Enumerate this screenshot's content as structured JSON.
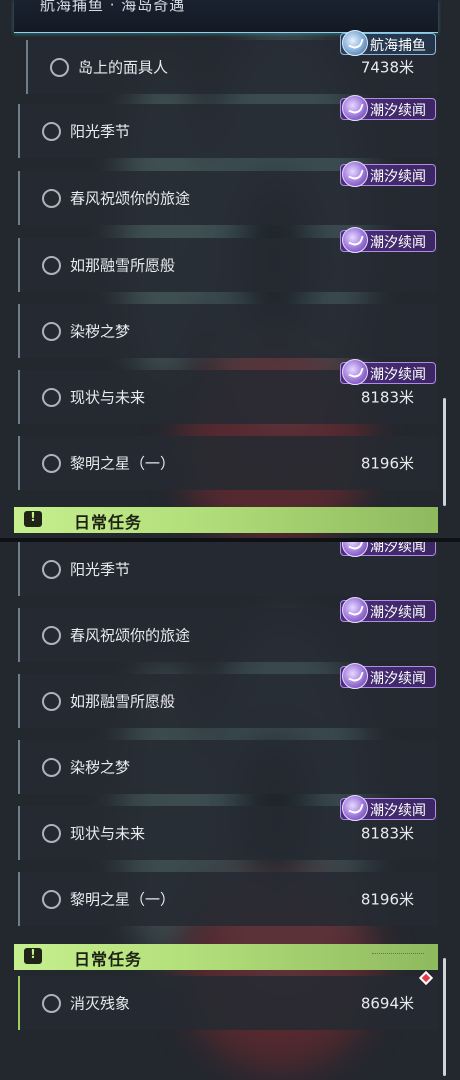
{
  "top_panel": {
    "header_text": "航海捕鱼 · 海岛奇遇",
    "quests": [
      {
        "title": "岛上的面具人",
        "distance": "7438米",
        "badge": "航海捕鱼"
      },
      {
        "title": "阳光季节",
        "distance": "",
        "badge": "潮汐续闻"
      },
      {
        "title": "春风祝颂你的旅途",
        "distance": "",
        "badge": "潮汐续闻"
      },
      {
        "title": "如那融雪所愿般",
        "distance": "",
        "badge": "潮汐续闻"
      },
      {
        "title": "染秽之梦",
        "distance": "",
        "badge": ""
      },
      {
        "title": "现状与未来",
        "distance": "8183米",
        "badge": "潮汐续闻"
      },
      {
        "title": "黎明之星（一）",
        "distance": "8196米",
        "badge": ""
      }
    ],
    "section_title": "日常任务"
  },
  "bottom_panel": {
    "partial_badge": "潮汐续闻",
    "quests": [
      {
        "title": "阳光季节",
        "distance": "",
        "badge": ""
      },
      {
        "title": "春风祝颂你的旅途",
        "distance": "",
        "badge": "潮汐续闻"
      },
      {
        "title": "如那融雪所愿般",
        "distance": "",
        "badge": "潮汐续闻"
      },
      {
        "title": "染秽之梦",
        "distance": "",
        "badge": ""
      },
      {
        "title": "现状与未来",
        "distance": "8183米",
        "badge": "潮汐续闻"
      },
      {
        "title": "黎明之星（一）",
        "distance": "8196米",
        "badge": ""
      }
    ],
    "section_title": "日常任务",
    "section_icon": "!",
    "daily_quests": [
      {
        "title": "消灭残象",
        "distance": "8694米"
      }
    ]
  },
  "icons": {
    "quest_status": "circle-outline-icon",
    "badge": "tide-swirl-icon",
    "section": "exclamation-icon",
    "marker": "red-diamond-icon"
  },
  "colors": {
    "accent_green": "#c6ef8e",
    "badge_purple": "#4a2f78",
    "header_cyan": "#7fd6e8",
    "marker_red": "#e23a4a"
  }
}
